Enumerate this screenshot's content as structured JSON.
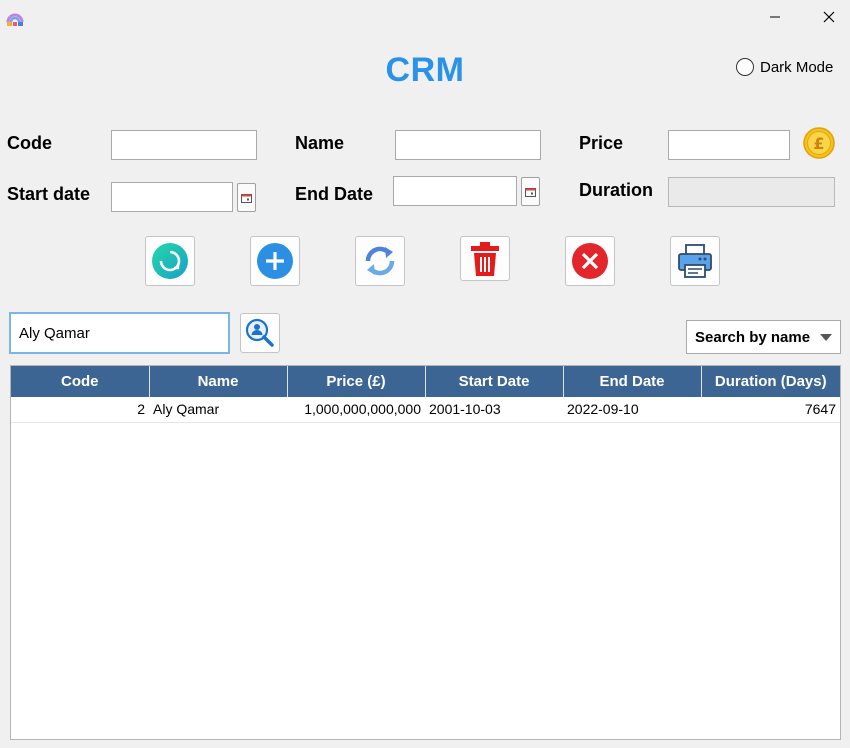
{
  "window": {
    "minimize_glyph": "—",
    "close_glyph": "✕"
  },
  "app": {
    "title": "CRM"
  },
  "dark_mode": {
    "label": "Dark Mode",
    "checked": false
  },
  "form": {
    "code": {
      "label": "Code",
      "value": ""
    },
    "name": {
      "label": "Name",
      "value": ""
    },
    "price": {
      "label": "Price",
      "value": ""
    },
    "start_date": {
      "label": "Start date",
      "value": ""
    },
    "end_date": {
      "label": "End Date",
      "value": ""
    },
    "duration": {
      "label": "Duration",
      "value": ""
    },
    "currency_symbol": "£"
  },
  "actions": [
    {
      "name": "refresh-load-button",
      "icon": "circular-arrow-icon"
    },
    {
      "name": "add-button",
      "icon": "plus-icon"
    },
    {
      "name": "update-button",
      "icon": "sync-icon"
    },
    {
      "name": "delete-button",
      "icon": "trash-icon"
    },
    {
      "name": "clear-button",
      "icon": "x-circle-icon"
    },
    {
      "name": "print-button",
      "icon": "printer-icon"
    }
  ],
  "search": {
    "value": "Aly Qamar",
    "mode": "Search by name"
  },
  "table": {
    "columns": [
      "Code",
      "Name",
      "Price (£)",
      "Start Date",
      "End Date",
      "Duration (Days)"
    ],
    "rows": [
      [
        "2",
        "Aly Qamar",
        "1,000,000,000,000",
        "2001-10-03",
        "2022-09-10",
        "7647"
      ]
    ]
  },
  "colors": {
    "title": "#2a93e8",
    "header_bg": "#3d6594"
  }
}
